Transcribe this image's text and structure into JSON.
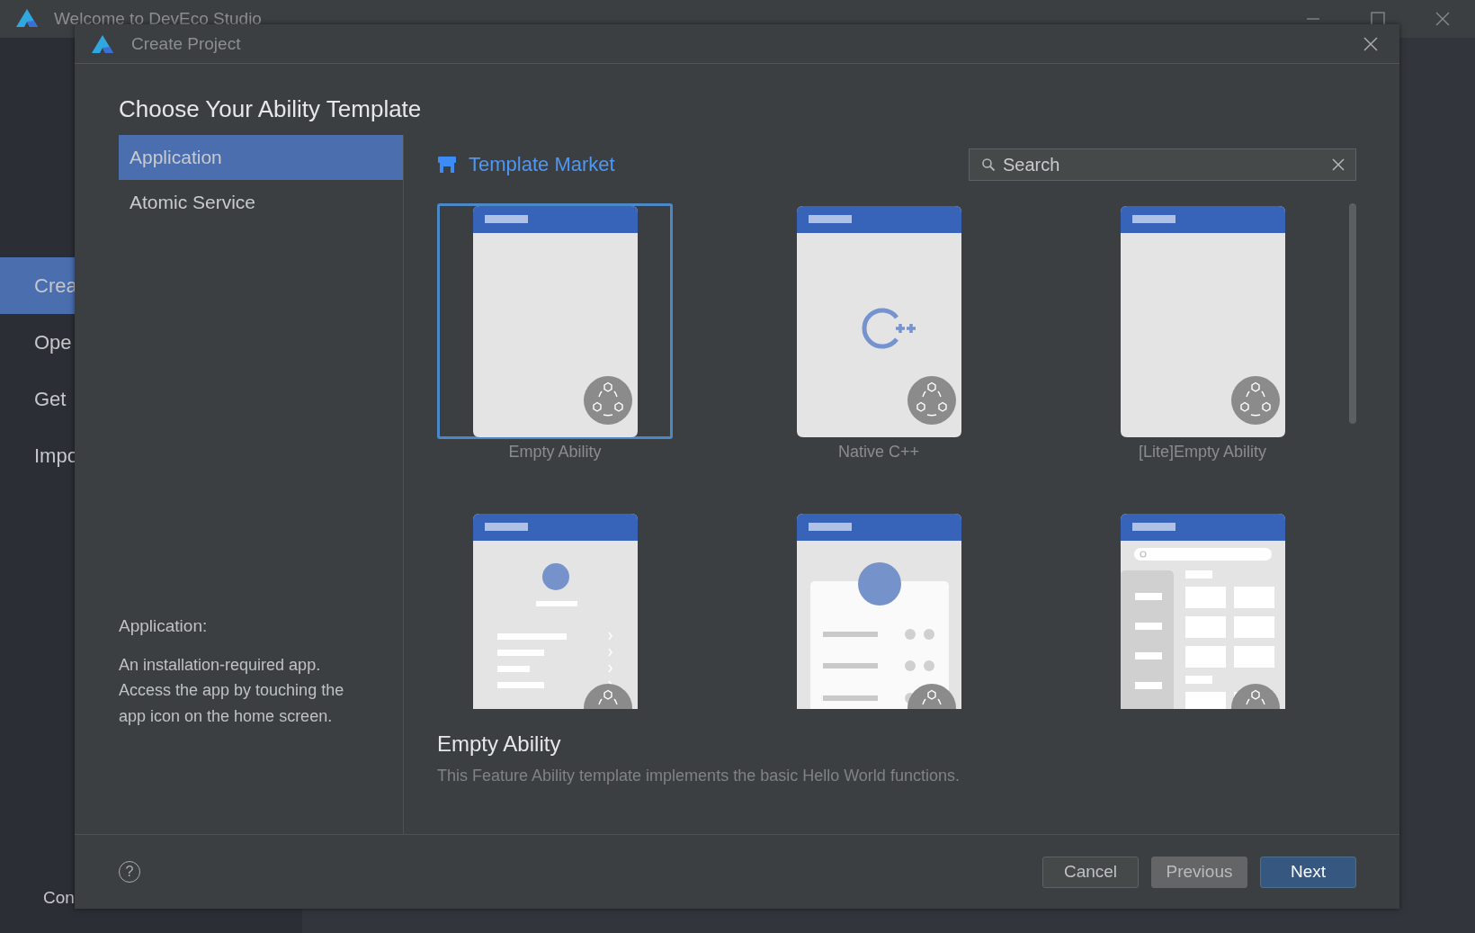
{
  "background_window": {
    "title": "Welcome to DevEco Studio",
    "sidebar_items": [
      {
        "label": "Crea",
        "selected": true
      },
      {
        "label": "Ope",
        "selected": false
      },
      {
        "label": "Get",
        "selected": false
      },
      {
        "label": "Impo",
        "selected": false
      }
    ],
    "footer_item": "Con"
  },
  "dialog": {
    "title": "Create Project",
    "heading": "Choose Your Ability Template",
    "categories": [
      {
        "label": "Application",
        "selected": true
      },
      {
        "label": "Atomic Service",
        "selected": false
      }
    ],
    "category_description": {
      "title": "Application:",
      "text": "An installation-required app. Access the app by touching the app icon on the home screen."
    },
    "template_market": {
      "label": "Template Market"
    },
    "search": {
      "placeholder": "Search"
    },
    "templates": [
      {
        "kind": "empty",
        "label": "Empty Ability",
        "selected": true
      },
      {
        "kind": "cpp",
        "label": "Native C++",
        "selected": false
      },
      {
        "kind": "empty",
        "label": "[Lite]Empty Ability",
        "selected": false
      },
      {
        "kind": "list",
        "selected": false
      },
      {
        "kind": "profile",
        "selected": false
      },
      {
        "kind": "grid",
        "selected": false
      }
    ],
    "selected_template": {
      "name": "Empty Ability",
      "description": "This Feature Ability template implements the basic Hello World functions."
    },
    "help_button": "?",
    "buttons": [
      {
        "label": "Cancel",
        "kind": "default"
      },
      {
        "label": "Previous",
        "kind": "muted"
      },
      {
        "label": "Next",
        "kind": "primary"
      }
    ]
  }
}
